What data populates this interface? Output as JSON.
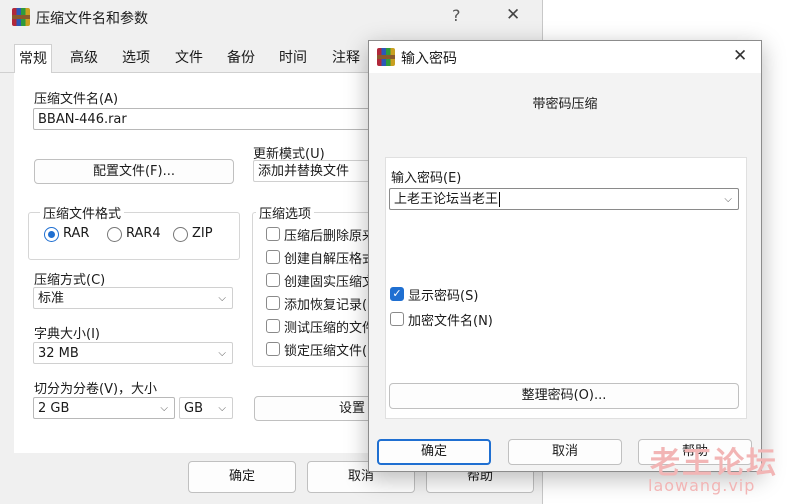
{
  "main": {
    "title": "压缩文件名和参数",
    "help_glyph": "?",
    "close_glyph": "✕",
    "tabs": [
      {
        "label": "常规"
      },
      {
        "label": "高级"
      },
      {
        "label": "选项"
      },
      {
        "label": "文件"
      },
      {
        "label": "备份"
      },
      {
        "label": "时间"
      },
      {
        "label": "注释"
      }
    ],
    "archive_name_label": "压缩文件名(A)",
    "archive_name_value": "BBAN-446.rar",
    "profile_button": "配置文件(F)...",
    "update_mode_label": "更新模式(U)",
    "update_mode_value": "添加并替换文件",
    "format_group_label": "压缩文件格式",
    "formats": [
      {
        "label": "RAR",
        "selected": true
      },
      {
        "label": "RAR4",
        "selected": false
      },
      {
        "label": "ZIP",
        "selected": false
      }
    ],
    "method_label": "压缩方式(C)",
    "method_value": "标准",
    "dict_label": "字典大小(I)",
    "dict_value": "32 MB",
    "split_label": "切分为分卷(V)，大小",
    "split_value": "2 GB",
    "split_unit": "GB",
    "options_group_label": "压缩选项",
    "options": [
      {
        "label": "压缩后删除原来",
        "checked": false
      },
      {
        "label": "创建自解压格式",
        "checked": false
      },
      {
        "label": "创建固实压缩文",
        "checked": false
      },
      {
        "label": "添加恢复记录(",
        "checked": false
      },
      {
        "label": "测试压缩的文件",
        "checked": false
      },
      {
        "label": "锁定压缩文件(",
        "checked": false
      }
    ],
    "settings_button": "设置",
    "ok_button": "确定",
    "cancel_button": "取消",
    "help_button": "帮助"
  },
  "dialog": {
    "title": "输入密码",
    "close_glyph": "✕",
    "subtitle": "带密码压缩",
    "password_label": "输入密码(E)",
    "password_value": "上老王论坛当老王",
    "show_password_label": "显示密码(S)",
    "show_password_checked": true,
    "encrypt_names_label": "加密文件名(N)",
    "encrypt_names_checked": false,
    "organize_button": "整理密码(O)...",
    "ok_button": "确定",
    "cancel_button": "取消",
    "help_button": "帮助"
  },
  "watermark": {
    "text": "老王论坛",
    "url": "laowang.vip"
  },
  "colors": {
    "accent": "#1f6fd1",
    "watermark": "#f2b5b5"
  }
}
